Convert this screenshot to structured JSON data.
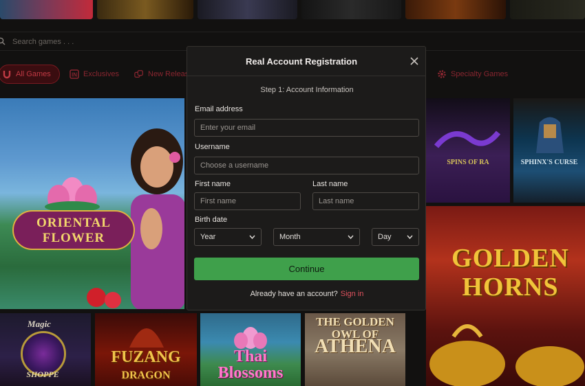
{
  "search": {
    "placeholder": "Search games . . ."
  },
  "categories": [
    {
      "label": "All Games",
      "icon": "horseshoe-icon",
      "active": true
    },
    {
      "label": "Exclusives",
      "icon": "in-badge-icon"
    },
    {
      "label": "New Releas",
      "icon": "dice-icon"
    },
    {
      "label": "Specialty Games",
      "icon": "gear-icon"
    }
  ],
  "games": {
    "oriental_flower": {
      "line1": "ORIENTAL",
      "line2": "FLOWER"
    },
    "spins_of_ra": {
      "label": "SPINS OF RA"
    },
    "sphinxs_curse": {
      "label": "SPHINX'S CURSE"
    },
    "golden_horns": {
      "line1": "GOLDEN",
      "line2": "HORNS"
    },
    "magic_shoppe": {
      "line1": "Magic",
      "line2": "SHOPPE"
    },
    "fuzang_dragon": {
      "line1": "FUZANG",
      "line2": "DRAGON"
    },
    "thai_blossoms": {
      "line1": "Thai",
      "line2": "Blossoms"
    },
    "golden_owl_athena": {
      "line1": "THE GOLDEN OWL OF",
      "line2": "ATHENA"
    }
  },
  "modal": {
    "title": "Real Account Registration",
    "step": "Step 1: Account Information",
    "email": {
      "label": "Email address",
      "placeholder": "Enter your email"
    },
    "username": {
      "label": "Username",
      "placeholder": "Choose a username"
    },
    "first_name": {
      "label": "First name",
      "placeholder": "First name"
    },
    "last_name": {
      "label": "Last name",
      "placeholder": "Last name"
    },
    "birth_date": {
      "label": "Birth date",
      "year": "Year",
      "month": "Month",
      "day": "Day"
    },
    "continue_label": "Continue",
    "signin_prompt": "Already have an account?",
    "signin_link": "Sign in"
  },
  "colors": {
    "accent_green": "#3fa04b",
    "accent_red": "#c23a44",
    "link": "#e0525e",
    "modal_bg": "#1c1b1a"
  }
}
